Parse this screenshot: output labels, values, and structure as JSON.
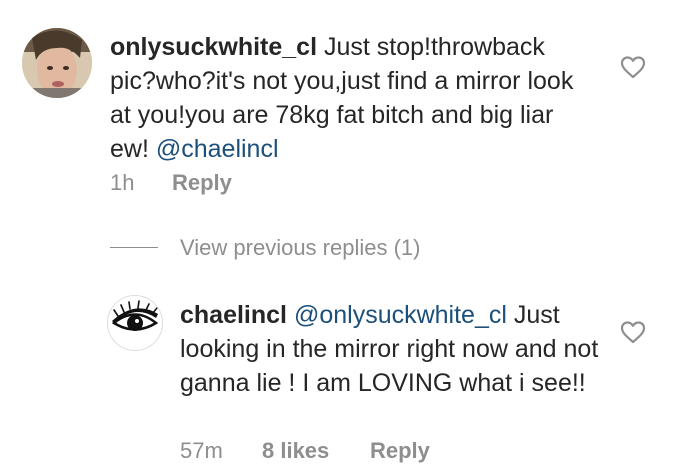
{
  "comment": {
    "username": "onlysuckwhite_cl",
    "text": " Just stop!throwback pic?who?it's not you,just find a mirror look at you!you are 78kg fat bitch and big liar ew! ",
    "mention": "@chaelincl",
    "time": "1h",
    "reply_label": "Reply",
    "avatar_icon": "user-photo-avatar",
    "like_icon": "heart-outline-icon"
  },
  "view_previous": {
    "label": "View previous replies (1)"
  },
  "reply": {
    "username": "chaelincl",
    "mention": "@onlysuckwhite_cl",
    "text": " Just looking in the mirror right now and not ganna lie ! I am LOVING what i see!!",
    "time": "57m",
    "likes": "8 likes",
    "reply_label": "Reply",
    "avatar_icon": "eye-avatar",
    "like_icon": "heart-outline-icon"
  },
  "colors": {
    "text": "#262626",
    "muted": "#8e8e8e",
    "mention": "#1c4f7a"
  }
}
